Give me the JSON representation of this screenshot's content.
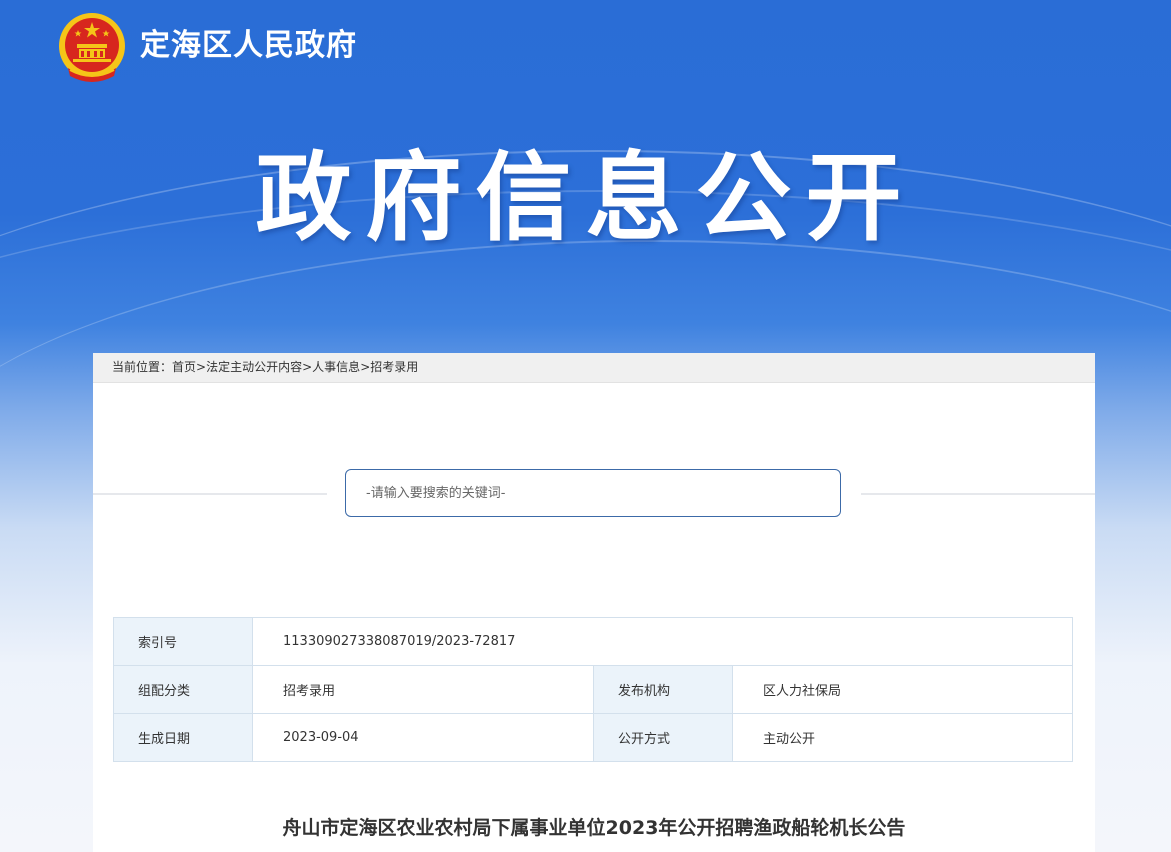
{
  "header": {
    "site_title": "定海区人民政府",
    "banner_title": "政府信息公开"
  },
  "breadcrumb": {
    "prefix": "当前位置：",
    "items": [
      "首页",
      "法定主动公开内容",
      "人事信息",
      "招考录用"
    ],
    "separator": ">"
  },
  "search": {
    "placeholder": "-请输入要搜索的关键词-"
  },
  "info": {
    "index_label": "索引号",
    "index_value": "113309027338087019/2023-72817",
    "category_label": "组配分类",
    "category_value": "招考录用",
    "publisher_label": "发布机构",
    "publisher_value": "区人力社保局",
    "date_label": "生成日期",
    "date_value": "2023-09-04",
    "mode_label": "公开方式",
    "mode_value": "主动公开"
  },
  "article": {
    "title": "舟山市定海区农业农村局下属事业单位2023年公开招聘渔政船轮机长公告"
  },
  "colors": {
    "banner_blue": "#2c6fd8",
    "emblem_red": "#d7261e",
    "emblem_gold": "#f5c518",
    "label_bg": "#ebf3fa"
  }
}
